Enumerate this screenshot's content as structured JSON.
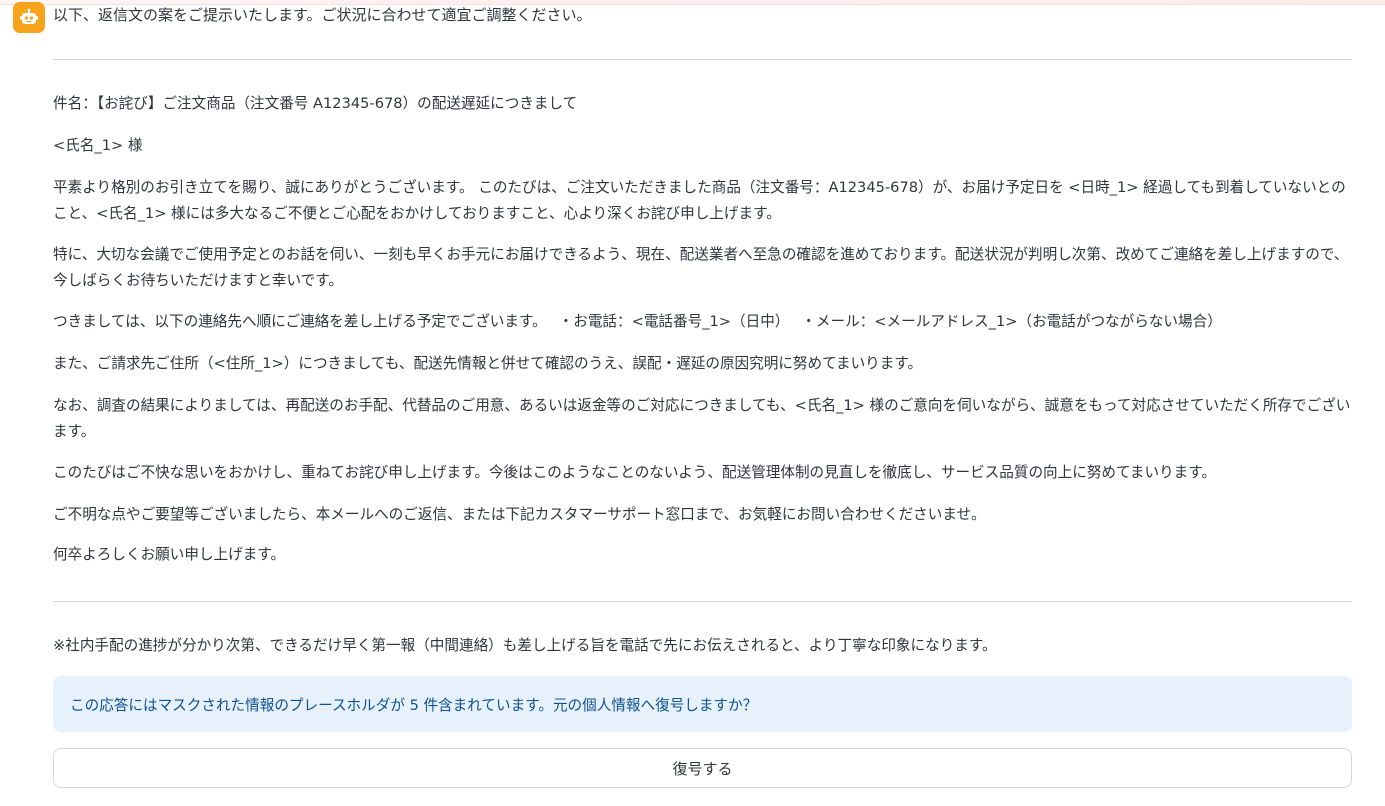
{
  "colors": {
    "avatar_bg": "#f7a21b",
    "info_bg": "#e7f1fb",
    "info_text": "#0e5294",
    "text": "#31333f"
  },
  "assistant": {
    "avatar_icon": "robot-icon",
    "intro": "以下、返信文の案をご提示いたします。ご状況に合わせて適宜ご調整ください。"
  },
  "email": {
    "subject": "件名：【お詫び】ご注文商品（注文番号 A12345-678）の配送遅延につきまして",
    "salutation": "<氏名_1> 様",
    "paragraphs": [
      "平素より格別のお引き立てを賜り、誠にありがとうございます。 このたびは、ご注文いただきました商品（注文番号：A12345-678）が、お届け予定日を <日時_1> 経過しても到着していないとのこと、<氏名_1> 様には多大なるご不便とご心配をおかけしておりますこと、心より深くお詫び申し上げます。",
      "特に、大切な会議でご使用予定とのお話を伺い、一刻も早くお手元にお届けできるよう、現在、配送業者へ至急の確認を進めております。配送状況が判明し次第、改めてご連絡を差し上げますので、今しばらくお待ちいただけますと幸いです。",
      "つきましては、以下の連絡先へ順にご連絡を差し上げる予定でございます。　 ・お電話：<電話番号_1>（日中）　 ・メール：<メールアドレス_1>（お電話がつながらない場合）",
      "また、ご請求先ご住所（<住所_1>）につきましても、配送先情報と併せて確認のうえ、誤配・遅延の原因究明に努めてまいります。",
      "なお、調査の結果によりましては、再配送のお手配、代替品のご用意、あるいは返金等のご対応につきましても、<氏名_1> 様のご意向を伺いながら、誠意をもって対応させていただく所存でございます。",
      "このたびはご不快な思いをおかけし、重ねてお詫び申し上げます。今後はこのようなことのないよう、配送管理体制の見直しを徹底し、サービス品質の向上に努めてまいります。",
      "ご不明な点やご要望等ございましたら、本メールへのご返信、または下記カスタマーサポート窓口まで、お気軽にお問い合わせくださいませ。",
      "何卒よろしくお願い申し上げます。"
    ]
  },
  "note": "※社内手配の進捗が分かり次第、できるだけ早く第一報（中間連絡）も差し上げる旨を電話で先にお伝えされると、より丁寧な印象になります。",
  "info_message": "この応答にはマスクされた情報のプレースホルダが 5 件含まれています。元の個人情報へ復号しますか？",
  "decrypt_button_label": "復号する"
}
